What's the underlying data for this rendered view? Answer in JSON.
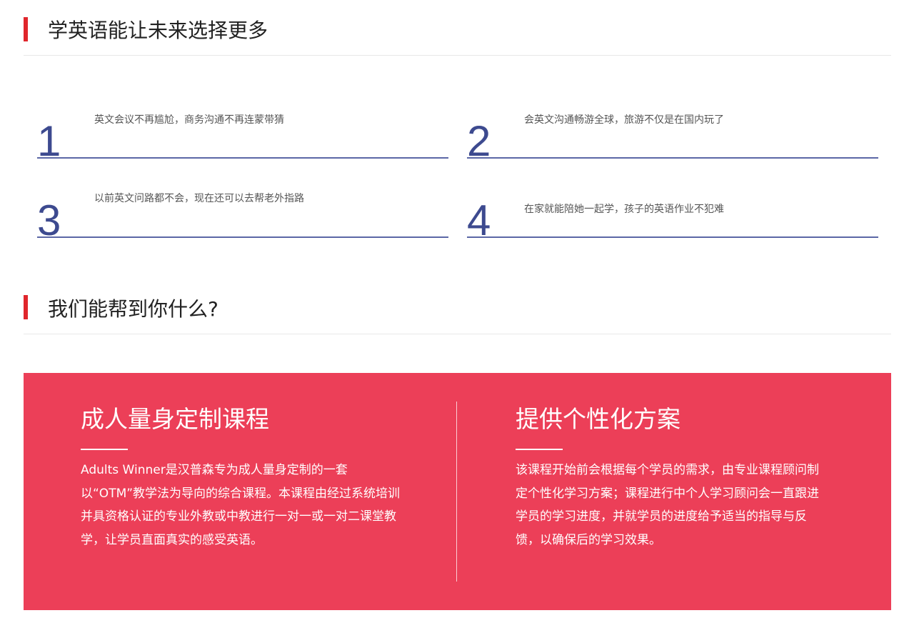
{
  "colors": {
    "accent_red": "#e0262c",
    "number_blue": "#3d4a8f",
    "line_blue": "#5b67a6",
    "panel_bg": "#ec3f58"
  },
  "section1": {
    "title": "学英语能让未来选择更多",
    "benefits": [
      {
        "number": "1",
        "text": "英文会议不再尴尬，商务沟通不再连蒙带猜"
      },
      {
        "number": "2",
        "text": "会英文沟通畅游全球，旅游不仅是在国内玩了"
      },
      {
        "number": "3",
        "text": "以前英文问路都不会，现在还可以去帮老外指路"
      },
      {
        "number": "4",
        "text": "在家就能陪她一起学，孩子的英语作业不犯难"
      }
    ]
  },
  "section2": {
    "title": "我们能帮到你什么?",
    "services": [
      {
        "title": "成人量身定制课程",
        "body": "Adults Winner是汉普森专为成人量身定制的一套以“OTM”教学法为导向的综合课程。本课程由经过系统培训并具资格认证的专业外教或中教进行一对一或一对二课堂教学，让学员直面真实的感受英语。"
      },
      {
        "title": "提供个性化方案",
        "body": "该课程开始前会根据每个学员的需求，由专业课程顾问制定个性化学习方案；课程进行中个人学习顾问会一直跟进学员的学习进度，并就学员的进度给予适当的指导与反馈，以确保后的学习效果。"
      }
    ]
  }
}
